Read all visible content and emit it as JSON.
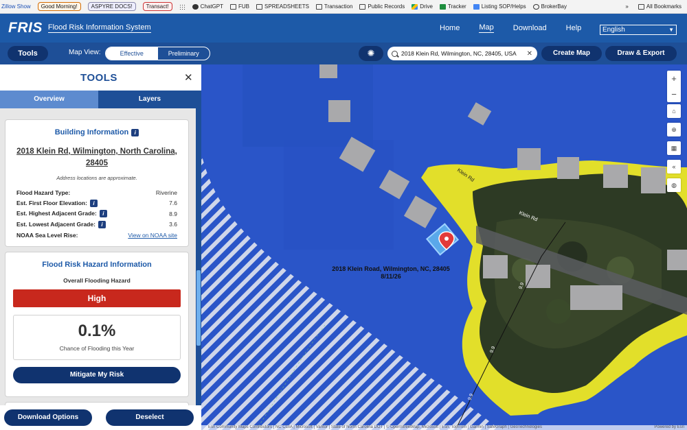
{
  "bookmarks": [
    {
      "label": "Zillow Show",
      "kind": "text"
    },
    {
      "label": "Good Morning!",
      "kind": "pill-orange"
    },
    {
      "label": "ASPYRE DOCS!",
      "kind": "pill-blue"
    },
    {
      "label": "Transact!",
      "kind": "pill-red"
    },
    {
      "label": "",
      "kind": "grid"
    },
    {
      "label": "ChatGPT",
      "kind": "circ"
    },
    {
      "label": "FUB",
      "kind": "folder"
    },
    {
      "label": "SPREADSHEETS",
      "kind": "folder"
    },
    {
      "label": "Transaction",
      "kind": "folder"
    },
    {
      "label": "Public Records",
      "kind": "folder"
    },
    {
      "label": "Drive",
      "kind": "drive"
    },
    {
      "label": "Tracker",
      "kind": "sheet"
    },
    {
      "label": "Listing SOP/Helps",
      "kind": "doc"
    },
    {
      "label": "BrokerBay",
      "kind": "bb"
    }
  ],
  "bookmarks_more": "»",
  "bookmarks_all": "All Bookmarks",
  "header": {
    "logo": "FRIS",
    "subtitle": "Flood Risk Information System",
    "nav": [
      "Home",
      "Map",
      "Download",
      "Help"
    ],
    "nav_active": "Map",
    "language": "English"
  },
  "toolbar": {
    "tools_label": "Tools",
    "map_view_label": "Map View:",
    "view_options": [
      "Effective",
      "Preliminary"
    ],
    "view_selected": "Effective",
    "search_value": "2018 Klein Rd, Wilmington, NC, 28405, USA",
    "create_map": "Create Map",
    "draw_export": "Draw & Export"
  },
  "panel": {
    "title": "TOOLS",
    "tabs": [
      "Overview",
      "Layers"
    ],
    "active_tab": "Overview",
    "building": {
      "title": "Building Information",
      "address_line1": "2018 Klein Rd, Wilmington, North Carolina,",
      "address_line2": "28405",
      "note": "Address locations are approximate.",
      "rows": [
        {
          "label": "Flood Hazard Type:",
          "value": "Riverine",
          "info": false
        },
        {
          "label": "Est. First Floor Elevation:",
          "value": "7.6",
          "info": true
        },
        {
          "label": "Est. Highest Adjacent Grade:",
          "value": "8.9",
          "info": true
        },
        {
          "label": "Est. Lowest Adjacent Grade:",
          "value": "3.6",
          "info": true
        },
        {
          "label": "NOAA Sea Level Rise:",
          "value": "View on NOAA site",
          "info": false,
          "link": true
        }
      ]
    },
    "hazard": {
      "title": "Flood Risk Hazard Information",
      "overall_label": "Overall Flooding Hazard",
      "level": "High",
      "level_color": "#c8281d",
      "chance": "0.1%",
      "chance_label": "Chance of Flooding this Year",
      "mitigate": "Mitigate My Risk"
    },
    "download": "Download Options",
    "deselect": "Deselect"
  },
  "map": {
    "label_line1": "2018 Klein Road, Wilmington, NC, 28405",
    "label_line2": "8/11/26",
    "street_labels": [
      "Klein Rd",
      "Klein Rd"
    ],
    "contour_labels": [
      "9.9",
      "9.9",
      "9.9"
    ],
    "attribution": "Esri Community Maps Contributors | NC CGIA | Microsoft | Vantor | State of North Carolina DOT | © OpenStreetMap, Microsoft | Esri, TomTom | Garmin | SafeGraph | GeoTechnologies",
    "powered": "Powered by Esri",
    "colors": {
      "flood": "#2a55c8",
      "zone_x": "#e2df2a",
      "aerial": "#2c3a1e"
    }
  }
}
